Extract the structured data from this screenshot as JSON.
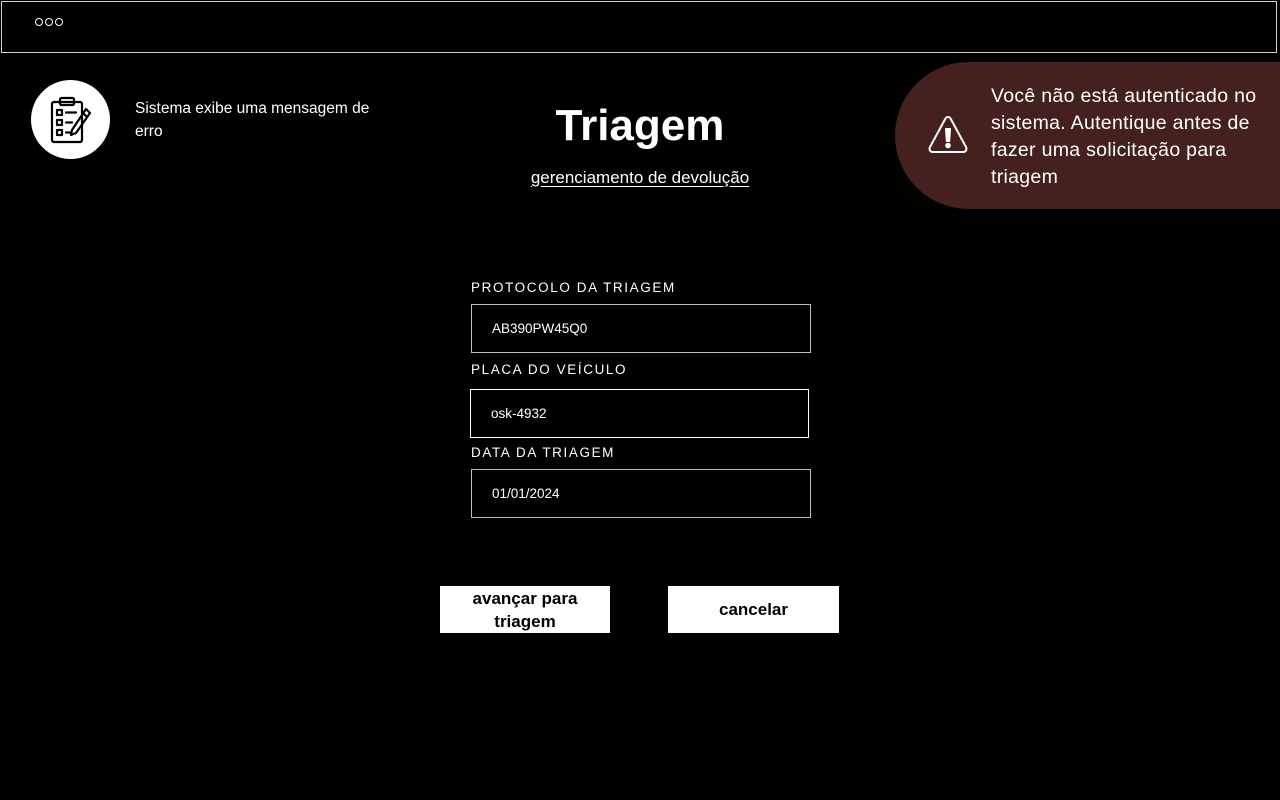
{
  "header": {
    "menu_icon": "three-dots-icon"
  },
  "app": {
    "icon": "clipboard-checklist-icon",
    "caption": "Sistema exibe uma mensagem de erro"
  },
  "page": {
    "title": "Triagem",
    "subtitle_link": "gerenciamento de devolução"
  },
  "alert": {
    "icon": "warning-triangle-icon",
    "message": "Você não está autenticado no sistema. Autentique antes de fazer uma solicitação para triagem",
    "background_color": "#44201e"
  },
  "form": {
    "protocol": {
      "label": "PROTOCOLO DA TRIAGEM",
      "value": "AB390PW45Q0"
    },
    "plate": {
      "label": "PLACA DO VEÍCULO",
      "value": "osk-4932"
    },
    "date": {
      "label": "DATA DA TRIAGEM",
      "value": "01/01/2024"
    }
  },
  "actions": {
    "advance_label": "avançar para triagem",
    "cancel_label": "cancelar"
  }
}
